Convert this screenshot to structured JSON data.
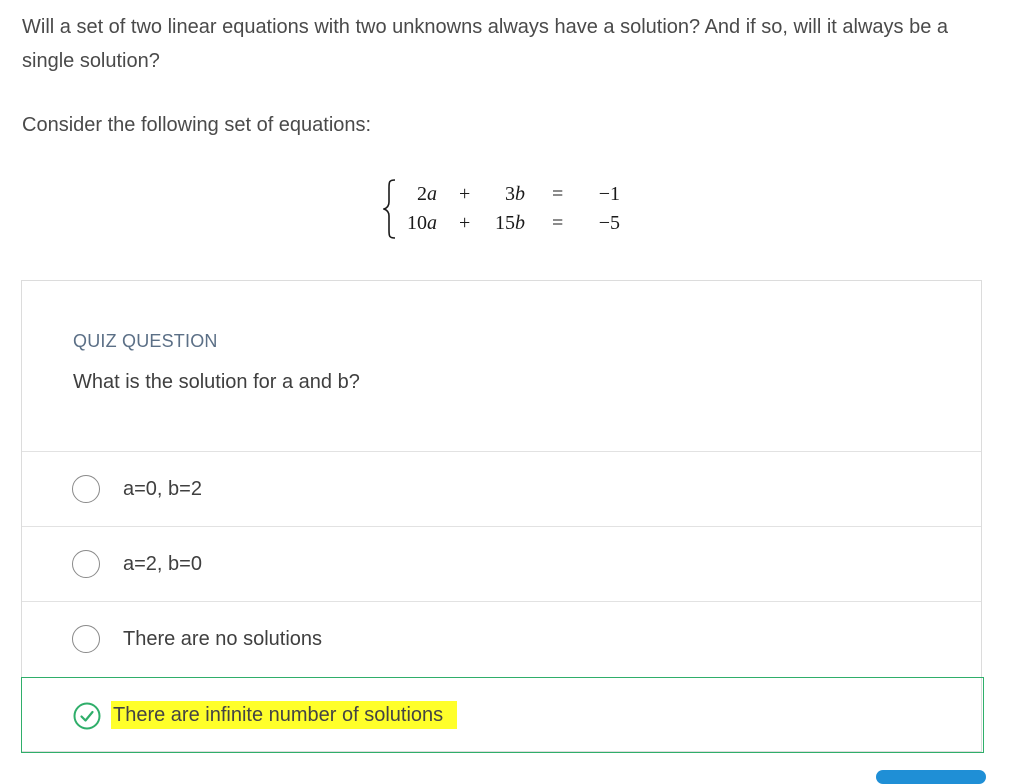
{
  "intro": "Will a set of two linear equations with two unknowns always have a solution? And if so, will it always be a single solution?",
  "consider": "Consider the following set of equations:",
  "equations": {
    "rows": [
      {
        "a_coef": "2",
        "a_var": "a",
        "op": "+",
        "b_coef": "3",
        "b_var": "b",
        "eq": "=",
        "value": "−1"
      },
      {
        "a_coef": "10",
        "a_var": "a",
        "op": "+",
        "b_coef": "15",
        "b_var": "b",
        "eq": "=",
        "value": "−5"
      }
    ]
  },
  "quiz": {
    "label": "QUIZ QUESTION",
    "question": "What is the solution for a and b?",
    "options": [
      {
        "text": "a=0, b=2",
        "selected": false,
        "correct": false
      },
      {
        "text": "a=2, b=0",
        "selected": false,
        "correct": false
      },
      {
        "text": "There are no solutions",
        "selected": false,
        "correct": false
      },
      {
        "text": "There are infinite number of solutions",
        "selected": true,
        "correct": true
      }
    ],
    "correct_color": "#2fae6a",
    "highlight_color": "#ffff2a"
  }
}
